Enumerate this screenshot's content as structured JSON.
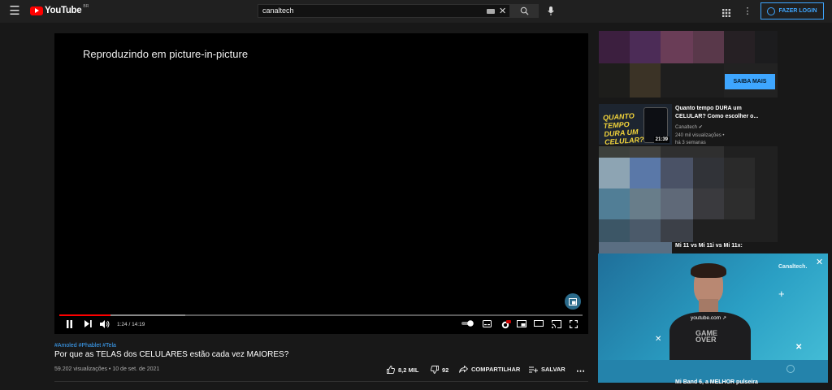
{
  "header": {
    "logo_text": "YouTube",
    "logo_country": "BR",
    "search_value": "canaltech",
    "login_label": "FAZER LOGIN"
  },
  "player": {
    "pip_message": "Reproduzindo em picture-in-picture",
    "current_time": "1:24",
    "duration": "14:19",
    "time_display": "1:24 / 14:19",
    "progress": 0.098,
    "buffered": 0.24
  },
  "video": {
    "hashtags": "#Amoled #Phablet #Tela",
    "title": "Por que as TELAS dos CELULARES estão cada vez MAIORES?",
    "meta": "59.202 visualizações • 10 de set. de 2021",
    "likes": "8,2 MIL",
    "dislikes": "92",
    "share_label": "COMPARTILHAR",
    "save_label": "SALVAR"
  },
  "sidebar": {
    "ad_button": "SAIBA MAIS",
    "recommendations": [
      {
        "title": "Quanto tempo DURA um CELULAR? Como escolher o...",
        "channel": "Canaltech",
        "views": "240 mil visualizações •",
        "age": "há 3 semanas",
        "duration": "21:39",
        "thumb_text": "QUANTO TEMPO DURA UM CELULAR?"
      },
      {
        "title": "Mi 11 vs Mi 11i vs Mi 11x:"
      },
      {
        "title": "Mi Band 6, a MELHOR pulseira"
      }
    ]
  },
  "mini_player": {
    "brand": "Canaltech.",
    "link": "youtube.com"
  },
  "colors": {
    "accent": "#3ea6ff",
    "youtube_red": "#ff0000",
    "background": "#181818"
  }
}
